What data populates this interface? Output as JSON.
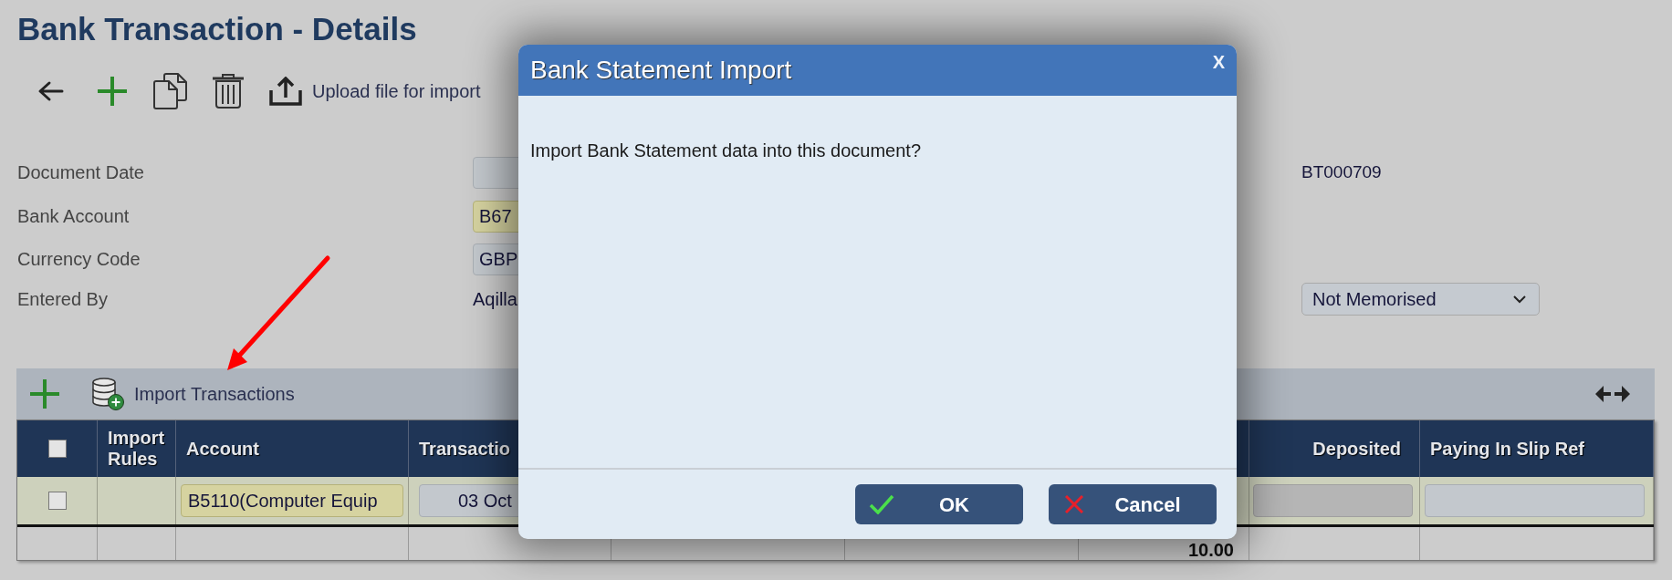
{
  "page": {
    "title": "Bank Transaction - Details"
  },
  "toolbar": {
    "upload_button": {
      "label": "Upload file for import"
    }
  },
  "form": {
    "fields": [
      {
        "label": "Document Date",
        "kind": "input"
      },
      {
        "label": "Bank Account",
        "kind": "lookup",
        "value": "B67"
      },
      {
        "label": "Currency Code",
        "kind": "input",
        "value": "GBP"
      },
      {
        "label": "Entered By",
        "kind": "text",
        "value": "Aqilla"
      }
    ],
    "document_number": "BT000709",
    "memorise_select": {
      "value": "Not Memorised"
    }
  },
  "grid": {
    "toolbar": {
      "import_button": {
        "label": "Import Transactions"
      }
    },
    "columns": [
      {
        "kind": "checkbox",
        "checked": false
      },
      {
        "kind": "text",
        "label": "Import Rules"
      },
      {
        "kind": "text",
        "label": "Account"
      },
      {
        "kind": "text",
        "label": "Transactio"
      },
      {
        "kind": "amount",
        "label": "Deposited"
      },
      {
        "kind": "text",
        "label": "Paying In Slip Ref"
      }
    ],
    "rows": [
      {
        "cells": [
          {
            "kind": "checkbox",
            "checked": false
          },
          {
            "kind": "blank"
          },
          {
            "kind": "lookup",
            "value": "B5110(Computer Equip"
          },
          {
            "kind": "date",
            "value": "03 Oct"
          },
          {
            "kind": "input",
            "disabled": true
          },
          {
            "kind": "input",
            "disabled": false
          }
        ]
      }
    ],
    "totals": {
      "column_7": "10.00"
    }
  },
  "dialog": {
    "title": "Bank Statement Import",
    "close": "X",
    "message": "Import Bank Statement data into this document?",
    "buttons": [
      {
        "kind": "ok",
        "label": "OK"
      },
      {
        "kind": "cancel",
        "label": "Cancel"
      }
    ]
  }
}
